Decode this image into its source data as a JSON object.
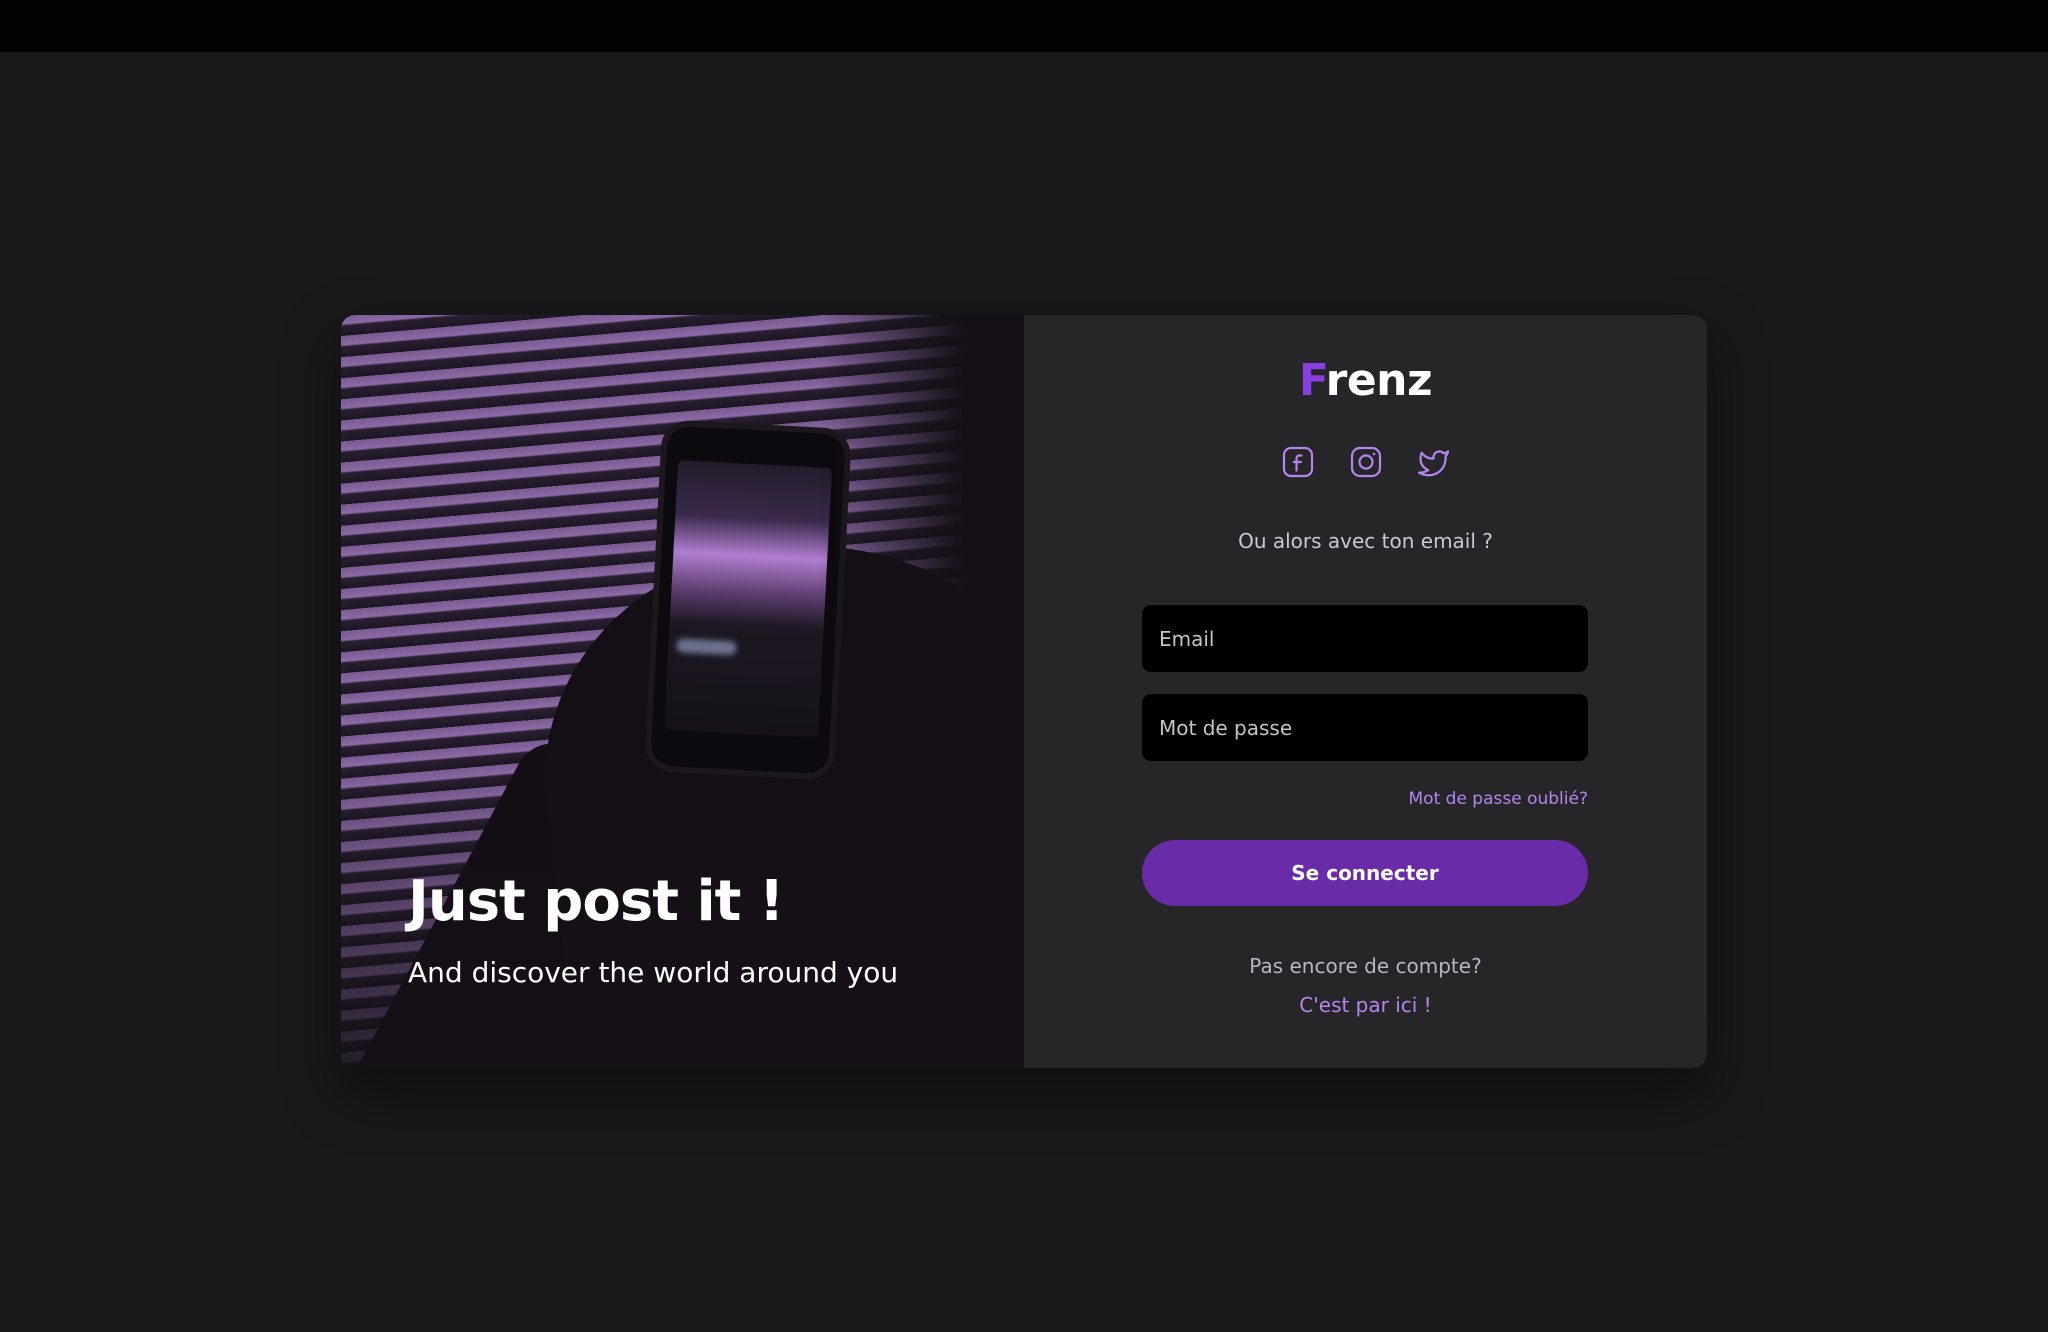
{
  "brand": {
    "logo_initial": "F",
    "logo_rest": "renz",
    "accent_color": "#8b3fe0"
  },
  "hero": {
    "title": "Just post it !",
    "subtitle": "And discover the world around you"
  },
  "social": {
    "items": [
      {
        "name": "facebook",
        "icon": "facebook-icon"
      },
      {
        "name": "instagram",
        "icon": "instagram-icon"
      },
      {
        "name": "twitter",
        "icon": "twitter-icon"
      }
    ]
  },
  "form": {
    "divider_text": "Ou alors avec ton email ?",
    "email_placeholder": "Email",
    "password_placeholder": "Mot de passe",
    "forgot_password": "Mot de passe oublié?",
    "submit_label": "Se connecter",
    "no_account_text": "Pas encore de compte?",
    "signup_link": "C'est par ici !"
  },
  "colors": {
    "page_background": "#19191b",
    "panel_background": "#262628",
    "button_background": "#6a2ba8",
    "link_color": "#b584f0"
  }
}
